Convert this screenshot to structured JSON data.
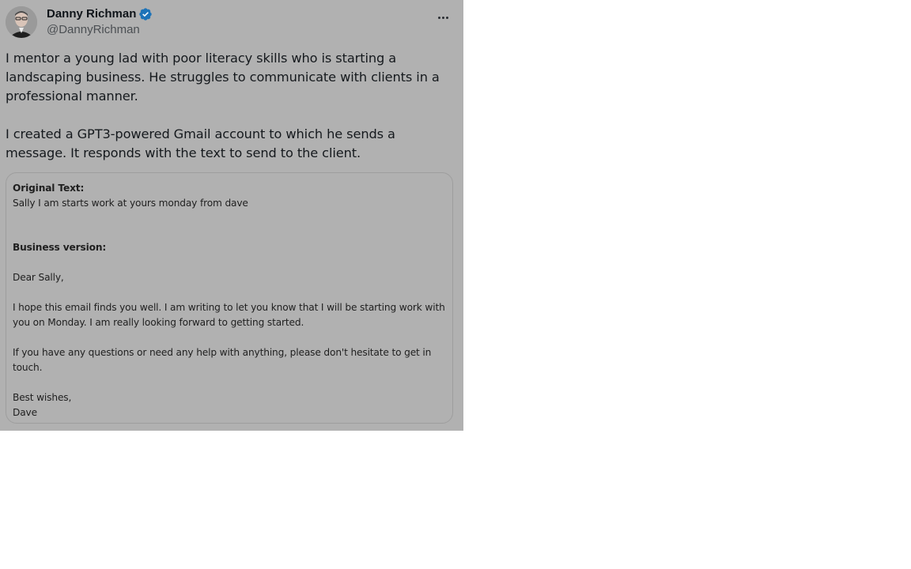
{
  "author": {
    "display_name": "Danny Richman",
    "handle": "@DannyRichman",
    "verified": true,
    "avatar_icon": "avatar-photo"
  },
  "tweet": {
    "paragraph_1": "I mentor a young lad with poor literacy skills who is starting a landscaping business. He struggles to communicate with clients in a professional manner.",
    "paragraph_2": "I created a GPT3-powered Gmail account to which he sends a message. It responds with the text to send to the client."
  },
  "image": {
    "original_heading": "Original Text:",
    "original_text": "Sally I am starts work at yours monday from dave",
    "business_heading": "Business version:",
    "greeting": "Dear Sally,",
    "body_1": "I hope this email finds you well. I am writing to let you know that I will be starting work with you on Monday. I am really looking forward to getting started.",
    "body_2": "If you have any questions or need any help with anything, please don't hesitate to get in touch.",
    "signoff": "Best wishes,",
    "signature": "Dave"
  },
  "colors": {
    "overlay_background": "#b1b1b1",
    "verified_badge": "#1d9bf0",
    "text": "#0f1419"
  }
}
